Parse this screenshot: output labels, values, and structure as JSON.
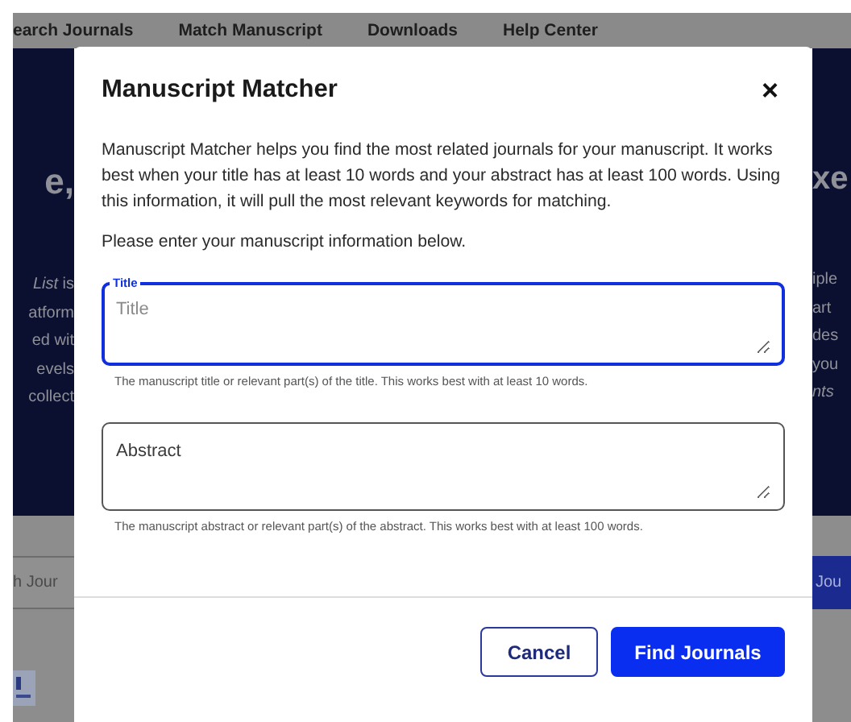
{
  "nav": {
    "items": [
      "earch Journals",
      "Match Manuscript",
      "Downloads",
      "Help Center"
    ]
  },
  "background": {
    "headline_left": "e,",
    "headline_right": "xe",
    "lines_left": [
      {
        "text": "*List* is"
      },
      {
        "text": "atform"
      },
      {
        "text": "ed wit"
      },
      {
        "text": "evels"
      },
      {
        "text": "collect"
      }
    ],
    "lines_right": [
      {
        "text": "iple",
        "italic": false
      },
      {
        "text": "art",
        "italic": false
      },
      {
        "text": "des",
        "italic": false
      },
      {
        "text": "you",
        "italic": false
      },
      {
        "text": "nts",
        "italic": true
      }
    ],
    "search_field": {
      "value": "h Jour"
    },
    "search_button": "Jou"
  },
  "dialog": {
    "title": "Manuscript Matcher",
    "close": "×",
    "intro": "Manuscript Matcher helps you find the most related journals for your manuscript. It works best when your title has at least 10 words and your abstract has at least 100 words. Using this information, it will pull the most relevant keywords for matching.",
    "prompt": "Please enter your manuscript information below.",
    "fields": [
      {
        "label": "Title",
        "placeholder": "Title",
        "focused": true,
        "hint": "The manuscript title or relevant part(s) of the title. This works best with at least 10 words."
      },
      {
        "placeholder": "Abstract",
        "focused": false,
        "hint": "The manuscript abstract or relevant part(s) of the abstract. This works best with at least 100 words."
      }
    ],
    "buttons": [
      {
        "label": "Cancel",
        "kind": "secondary"
      },
      {
        "label": "Find Journals",
        "kind": "primary"
      }
    ]
  }
}
